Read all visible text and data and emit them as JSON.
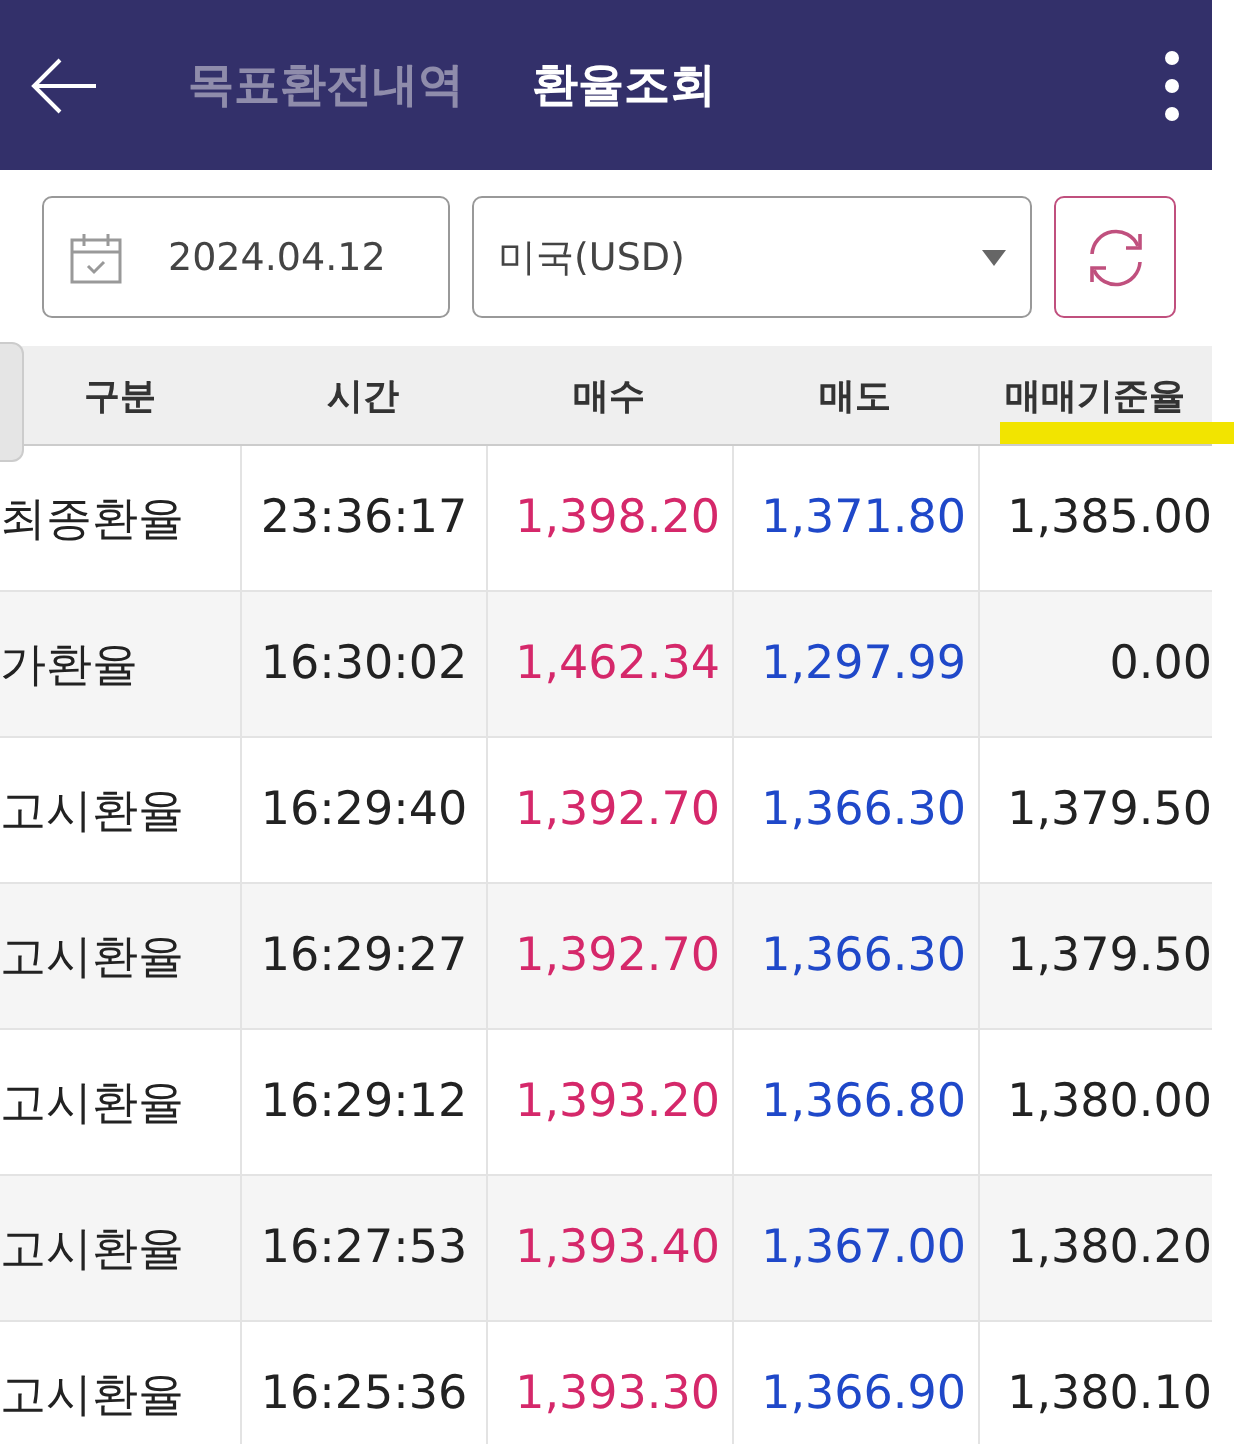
{
  "header": {
    "tabs": [
      {
        "label": "목표환전내역",
        "selected": false
      },
      {
        "label": "환율조회",
        "selected": true
      }
    ]
  },
  "filters": {
    "date": "2024.04.12",
    "currency": "미국(USD)"
  },
  "table": {
    "columns": [
      "구분",
      "시간",
      "매수",
      "매도",
      "매매기준율"
    ],
    "rows": [
      {
        "type": "최종환율",
        "time": "23:36:17",
        "buy": "1,398.20",
        "sell": "1,371.80",
        "base": "1,385.00"
      },
      {
        "type": "가환율",
        "time": "16:30:02",
        "buy": "1,462.34",
        "sell": "1,297.99",
        "base": "0.00"
      },
      {
        "type": "고시환율",
        "time": "16:29:40",
        "buy": "1,392.70",
        "sell": "1,366.30",
        "base": "1,379.50"
      },
      {
        "type": "고시환율",
        "time": "16:29:27",
        "buy": "1,392.70",
        "sell": "1,366.30",
        "base": "1,379.50"
      },
      {
        "type": "고시환율",
        "time": "16:29:12",
        "buy": "1,393.20",
        "sell": "1,366.80",
        "base": "1,380.00"
      },
      {
        "type": "고시환율",
        "time": "16:27:53",
        "buy": "1,393.40",
        "sell": "1,367.00",
        "base": "1,380.20"
      },
      {
        "type": "고시환율",
        "time": "16:25:36",
        "buy": "1,393.30",
        "sell": "1,366.90",
        "base": "1,380.10"
      }
    ]
  }
}
